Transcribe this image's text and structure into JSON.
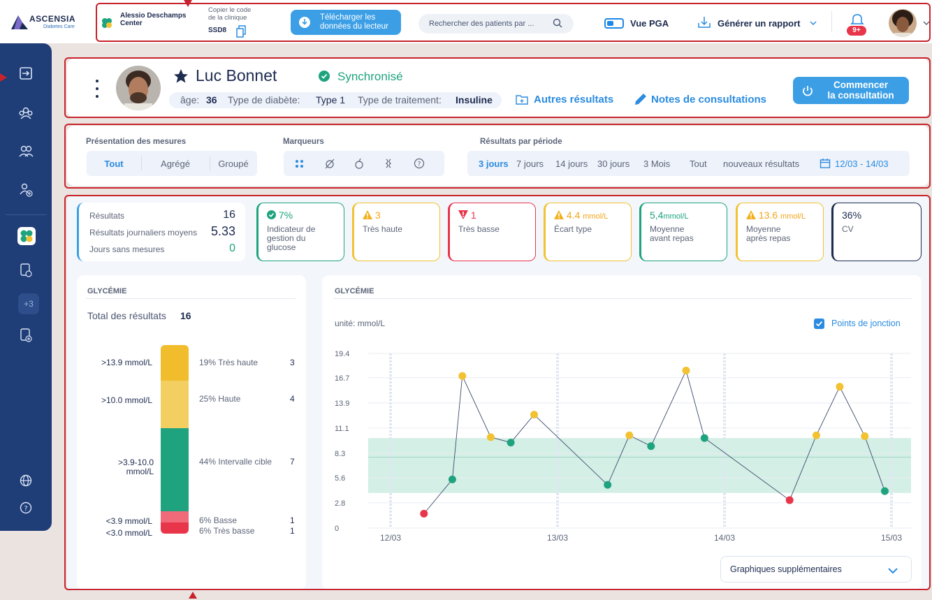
{
  "header": {
    "logo": "ASCENSIA",
    "logo_sub": "Diabetes Care",
    "clinic_line1": "Alessio Deschamps",
    "clinic_line2": "Center",
    "copy_label_1": "Copier le code",
    "copy_label_2": "de la clinique",
    "clinic_code": "SSD8",
    "download_line1": "Télécharger les",
    "download_line2": "données du lecteur",
    "search_placeholder": "Rechercher des patients par ...",
    "pga_label": "Vue PGA",
    "report_label": "Générer un rapport",
    "notif_badge": "9+"
  },
  "patient": {
    "name": "Luc Bonnet",
    "status": "Synchronisé",
    "age_label": "âge:",
    "age": "36",
    "diabetes_label": "Type de diabète:",
    "diabetes": "Type 1",
    "treatment_label": "Type de traitement:",
    "treatment": "Insuline",
    "other_results": "Autres résultats",
    "notes": "Notes de consultations",
    "start_line1": "Commencer",
    "start_line2": "la consultation"
  },
  "filters": {
    "presentation_title": "Présentation des mesures",
    "presentation": [
      "Tout",
      "Agrégé",
      "Groupé"
    ],
    "markers_title": "Marqueurs",
    "period_title": "Résultats par période",
    "periods": [
      "3 jours",
      "7 jours",
      "14 jours",
      "30 jours",
      "3 Mois",
      "Tout",
      "nouveaux résultats"
    ],
    "date_range": "12/03 - 14/03"
  },
  "summary": {
    "results_label": "Résultats",
    "results": "16",
    "daily_label": "Résultats journaliers moyens",
    "daily": "5.33",
    "days_label": "Jours sans mesures",
    "days": "0"
  },
  "metrics": [
    {
      "value": "7%",
      "unit": "",
      "text": "Indicateur de gestion du glucose",
      "color": "#1fa37f"
    },
    {
      "value": "3",
      "unit": "",
      "text": "Très haute",
      "color": "#f2c233"
    },
    {
      "value": "1",
      "unit": "",
      "text": "Très basse",
      "color": "#e8354a"
    },
    {
      "value": "4.4",
      "unit": "mmol/L",
      "text": "Écart type",
      "color": "#f2c233"
    },
    {
      "value": "5,4",
      "unit": "mmol/L",
      "text": "Moyenne avant repas",
      "color": "#1fa37f"
    },
    {
      "value": "13.6",
      "unit": "mmol/L",
      "text": "Moyenne après repas",
      "color": "#f2c233"
    },
    {
      "value": "36%",
      "unit": "",
      "text": "CV",
      "color": "#1d2b4f"
    }
  ],
  "distribution": {
    "title": "GLYCÉMIE",
    "total_label": "Total des résultats",
    "total": "16",
    "bands": [
      {
        "range": ">13.9 mmol/L",
        "pct": "19%",
        "label": "Très haute",
        "count": "3",
        "color": "#f2bd2c",
        "fraction": 0.19
      },
      {
        "range": ">10.0 mmol/L",
        "pct": "25%",
        "label": "Haute",
        "count": "4",
        "color": "#f3cf62",
        "fraction": 0.25
      },
      {
        "range": ">3.9-10.0 mmol/L",
        "pct": "44%",
        "label": "Intervalle cible",
        "count": "7",
        "color": "#1fa37f",
        "fraction": 0.44
      },
      {
        "range": "<3.9 mmol/L",
        "pct": "6%",
        "label": "Basse",
        "count": "1",
        "color": "#f06a7a",
        "fraction": 0.06
      },
      {
        "range": "<3.0 mmol/L",
        "pct": "6%",
        "label": "Très basse",
        "count": "1",
        "color": "#e8354a",
        "fraction": 0.06
      }
    ]
  },
  "chart_panel": {
    "title": "GLYCÉMIE",
    "unit_label": "unité: mmol/L",
    "junction_label": "Points de jonction",
    "more_charts": "Graphiques supplémentaires"
  },
  "chart_data": {
    "type": "line",
    "ylim": [
      0,
      19.4
    ],
    "yticks": [
      "19.4",
      "16.7",
      "13.9",
      "11.1",
      "8.3",
      "5.6",
      "2.8",
      "0"
    ],
    "x_labels": [
      "12/03",
      "13/03",
      "14/03",
      "15/03"
    ],
    "target_range": [
      3.9,
      10.0
    ],
    "points": [
      {
        "day": 0.2,
        "value": 1.6,
        "color": "#e8354a"
      },
      {
        "day": 0.37,
        "value": 5.4,
        "color": "#1fa37f"
      },
      {
        "day": 0.43,
        "value": 16.9,
        "color": "#f2c233"
      },
      {
        "day": 0.6,
        "value": 10.1,
        "color": "#f2c233"
      },
      {
        "day": 0.72,
        "value": 9.5,
        "color": "#1fa37f"
      },
      {
        "day": 0.86,
        "value": 12.6,
        "color": "#f2c233"
      },
      {
        "day": 1.3,
        "value": 4.8,
        "color": "#1fa37f"
      },
      {
        "day": 1.43,
        "value": 10.3,
        "color": "#f2c233"
      },
      {
        "day": 1.56,
        "value": 9.1,
        "color": "#1fa37f"
      },
      {
        "day": 1.77,
        "value": 17.5,
        "color": "#f2c233"
      },
      {
        "day": 1.88,
        "value": 10.0,
        "color": "#1fa37f"
      },
      {
        "day": 2.39,
        "value": 3.1,
        "color": "#e8354a"
      },
      {
        "day": 2.55,
        "value": 10.3,
        "color": "#f2c233"
      },
      {
        "day": 2.69,
        "value": 15.7,
        "color": "#f2c233"
      },
      {
        "day": 2.84,
        "value": 10.2,
        "color": "#f2c233"
      },
      {
        "day": 2.96,
        "value": 4.1,
        "color": "#1fa37f"
      }
    ]
  }
}
